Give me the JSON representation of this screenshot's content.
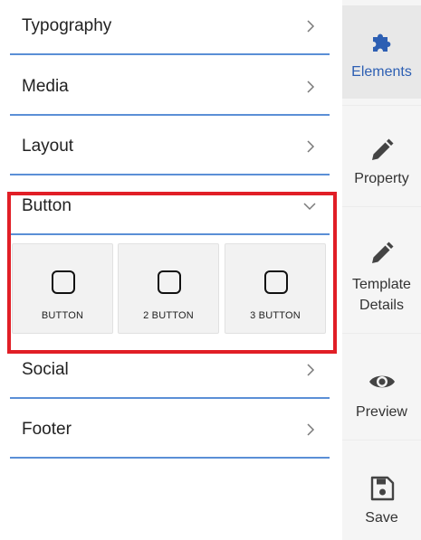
{
  "sections": {
    "typography": {
      "label": "Typography",
      "icon": "chevron-right-icon"
    },
    "media": {
      "label": "Media",
      "icon": "chevron-right-icon"
    },
    "layout": {
      "label": "Layout",
      "icon": "chevron-right-icon"
    },
    "button": {
      "label": "Button",
      "icon": "chevron-down-icon",
      "expanded": true,
      "items": [
        {
          "label": "BUTTON",
          "icon": "rounded-square-icon"
        },
        {
          "label": "2 BUTTON",
          "icon": "rounded-square-icon"
        },
        {
          "label": "3 BUTTON",
          "icon": "rounded-square-icon"
        }
      ]
    },
    "social": {
      "label": "Social",
      "icon": "chevron-right-icon"
    },
    "footer": {
      "label": "Footer",
      "icon": "chevron-right-icon"
    }
  },
  "sidebar": {
    "items": [
      {
        "label": "Elements",
        "icon": "puzzle-icon",
        "active": true
      },
      {
        "label": "Property",
        "icon": "pencil-icon",
        "active": false
      },
      {
        "label": "Template Details",
        "icon": "pencil-icon",
        "active": false
      },
      {
        "label": "Preview",
        "icon": "eye-icon",
        "active": false
      },
      {
        "label": "Save",
        "icon": "floppy-disk-icon",
        "active": false
      }
    ]
  },
  "colors": {
    "accent": "#2d5fb3",
    "divider": "#5b8fd6",
    "highlight": "#e11e26",
    "sidebar_bg": "#f5f5f5",
    "tile_bg": "#f2f2f2"
  }
}
